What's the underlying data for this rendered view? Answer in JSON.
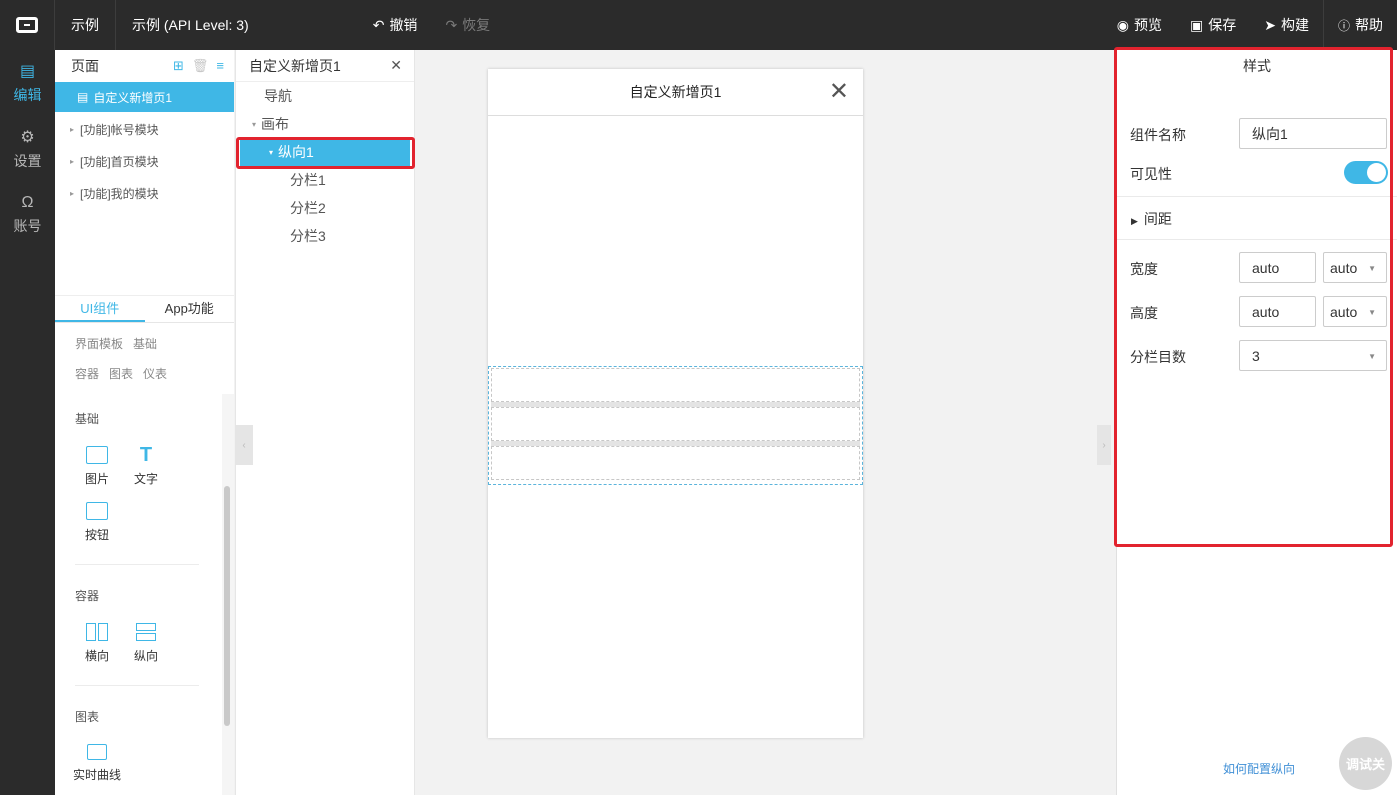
{
  "topbar": {
    "project": "示例",
    "project_full": "示例 (API Level: 3)",
    "undo": "撤销",
    "redo": "恢复",
    "preview": "预览",
    "save": "保存",
    "build": "构建",
    "help": "帮助"
  },
  "rail": [
    {
      "label": "编辑",
      "icon": "edit-icon"
    },
    {
      "label": "设置",
      "icon": "settings-icon"
    },
    {
      "label": "账号",
      "icon": "account-icon"
    }
  ],
  "pages": {
    "title": "页面",
    "items": [
      "自定义新增页1",
      "[功能]帐号模块",
      "[功能]首页模块",
      "[功能]我的模块"
    ]
  },
  "library": {
    "tabs": [
      "UI组件",
      "App功能"
    ],
    "categories": [
      "界面模板",
      "基础",
      "容器",
      "图表",
      "仪表"
    ],
    "sections": {
      "basic": {
        "title": "基础",
        "items": [
          "图片",
          "文字",
          "按钮"
        ]
      },
      "container": {
        "title": "容器",
        "items": [
          "横向",
          "纵向"
        ]
      },
      "chart": {
        "title": "图表",
        "items": [
          "实时曲线"
        ]
      }
    }
  },
  "tree": {
    "title": "自定义新增页1",
    "items": [
      "导航",
      "画布",
      "纵向1",
      "分栏1",
      "分栏2",
      "分栏3"
    ]
  },
  "canvas": {
    "page_title": "自定义新增页1"
  },
  "props": {
    "title": "样式",
    "name_label": "组件名称",
    "name_value": "纵向1",
    "visible_label": "可见性",
    "visible": true,
    "padding_label": "间距",
    "width_label": "宽度",
    "width_value": "auto",
    "width_unit": "auto",
    "height_label": "高度",
    "height_value": "auto",
    "height_unit": "auto",
    "columns_label": "分栏目数",
    "columns_value": "3",
    "help_link": "如何配置纵向",
    "debug": "调试关"
  },
  "colors": {
    "accent": "#3fb7e6",
    "highlight": "#e2232e",
    "topbar": "#2b2b2b"
  }
}
